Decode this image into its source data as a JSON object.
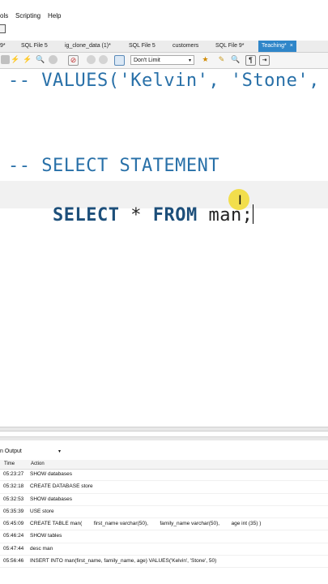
{
  "menu": {
    "tools_partial": "ols",
    "scripting": "Scripting",
    "help": "Help"
  },
  "tabs": [
    {
      "label": "9*"
    },
    {
      "label": "SQL File 5"
    },
    {
      "label": "ig_clone_data (1)*"
    },
    {
      "label": "SQL File 5"
    },
    {
      "label": "customers"
    },
    {
      "label": "SQL File 9*"
    },
    {
      "label": "Teaching*",
      "close": "×"
    }
  ],
  "toolbar": {
    "limit_label": "Don't Limit",
    "limit_arrow": "▾"
  },
  "editor": {
    "line1": "-- VALUES('Kelvin', 'Stone',",
    "line2": "-- SELECT STATEMENT",
    "line3_kw1": "SELECT",
    "line3_mid": " * ",
    "line3_kw2": "FROM",
    "line3_rest": " man;",
    "cursor_glyph": "I"
  },
  "output": {
    "selector": "n Output",
    "selector_arrow": "▾",
    "col_time": "Time",
    "col_action": "Action",
    "rows": [
      {
        "time": "05:23:27",
        "action": "SHOW databases"
      },
      {
        "time": "05:32:18",
        "action": "CREATE DATABASE store"
      },
      {
        "time": "05:32:53",
        "action": "SHOW databases"
      },
      {
        "time": "05:35:39",
        "action": "USE store"
      },
      {
        "time": "05:45:09",
        "action": "CREATE TABLE man(        first_name varchar(50),        family_name varchar(50),        age int (35) )"
      },
      {
        "time": "05:46:24",
        "action": "SHOW tables"
      },
      {
        "time": "05:47:44",
        "action": "desc man"
      },
      {
        "time": "05:56:46",
        "action": "INSERT INTO man(first_name, family_name, age) VALUES('Kelvin', 'Stone', 50)"
      }
    ]
  },
  "colors": {
    "active_tab": "#2f86c9",
    "comment": "#2870a8",
    "keyword": "#1d4f7a",
    "cursor_highlight": "#f2dc3a"
  }
}
